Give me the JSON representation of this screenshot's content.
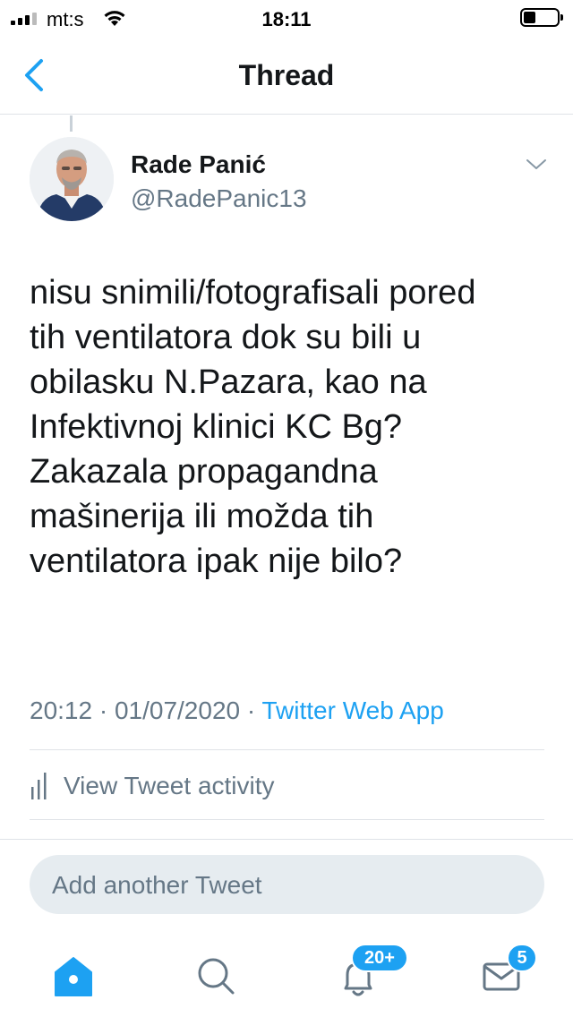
{
  "status_bar": {
    "carrier": "mt:s",
    "time": "18:11"
  },
  "nav": {
    "title": "Thread",
    "back_icon": "chevron-left-icon"
  },
  "tweet": {
    "author_name": "Rade Panić",
    "author_handle": "@RadePanic13",
    "text_lines": [
      "nisu snimili/fotografisali pored",
      "tih ventilatora dok su bili u",
      "obilasku N.Pazara, kao na",
      "Infektivnoj klinici KC Bg?",
      "Zakazala propagandna",
      "mašinerija ili možda tih",
      "ventilatora ipak nije bilo?"
    ],
    "timestamp": "20:12 · 01/07/2020 · ",
    "source": "Twitter Web App",
    "activity_label": "View Tweet activity"
  },
  "reply": {
    "placeholder": "Add another Tweet"
  },
  "tab_bar": {
    "tabs": [
      {
        "icon": "home-icon"
      },
      {
        "icon": "search-icon"
      },
      {
        "icon": "notifications-icon",
        "badge": "20+"
      },
      {
        "icon": "messages-icon",
        "badge": "5"
      }
    ]
  },
  "colors": {
    "accent": "#1da1f2",
    "text": "#14171a",
    "muted": "#657786",
    "divider": "#dfe3e7"
  }
}
